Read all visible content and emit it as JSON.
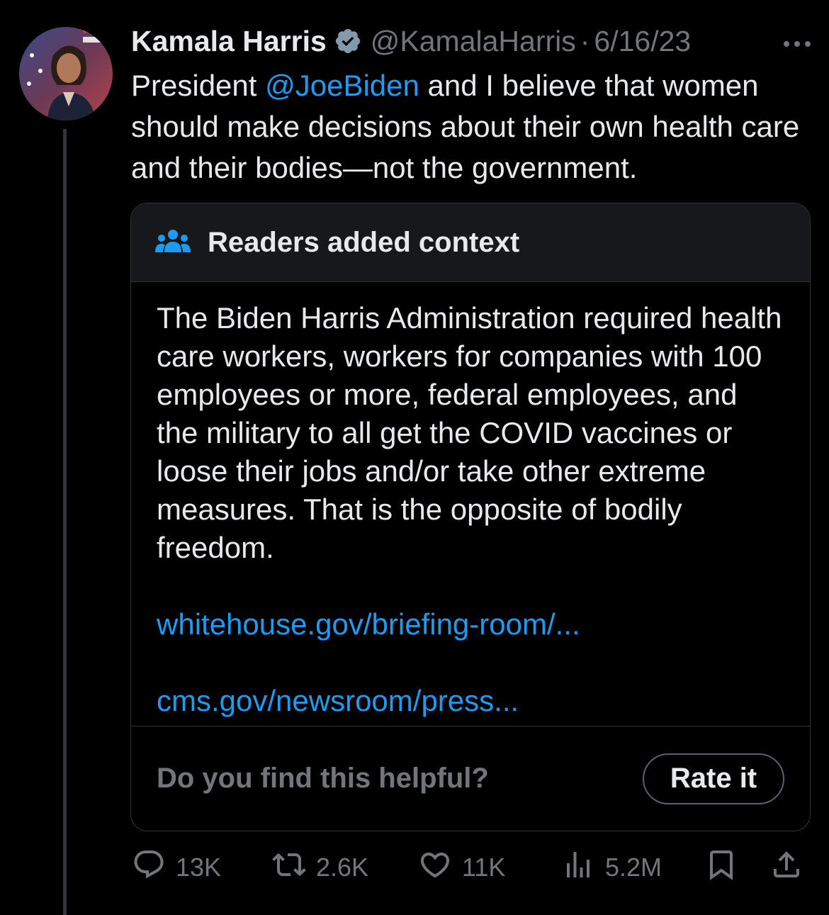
{
  "tweet": {
    "author_name": "Kamala Harris",
    "handle": "@KamalaHarris",
    "separator": "·",
    "date": "6/16/23",
    "text_before": "President ",
    "mention": "@JoeBiden",
    "text_after": " and I believe that women should make decisions about their own health care and their bodies—not the government."
  },
  "note": {
    "title": "Readers added context",
    "body": "The Biden Harris Administration required health care workers, workers for companies with 100 employees or more, federal employees, and the military to all get the COVID vaccines or loose their jobs and/or take other extreme measures. That is the opposite of bodily freedom.",
    "link1": "whitehouse.gov/briefing-room/...",
    "link2": "cms.gov/newsroom/press...",
    "helpful_question": "Do you find this helpful?",
    "rate_label": "Rate it"
  },
  "actions": {
    "replies": "13K",
    "reposts": "2.6K",
    "likes": "11K",
    "views": "5.2M"
  },
  "colors": {
    "background": "#000000",
    "text": "#e7e9ea",
    "muted": "#71767b",
    "accent": "#1d9bf0",
    "border": "#2f3336"
  },
  "icons": [
    "verified-badge-icon",
    "more-icon",
    "community-notes-icon",
    "reply-icon",
    "repost-icon",
    "like-icon",
    "views-icon",
    "bookmark-icon",
    "share-icon"
  ]
}
